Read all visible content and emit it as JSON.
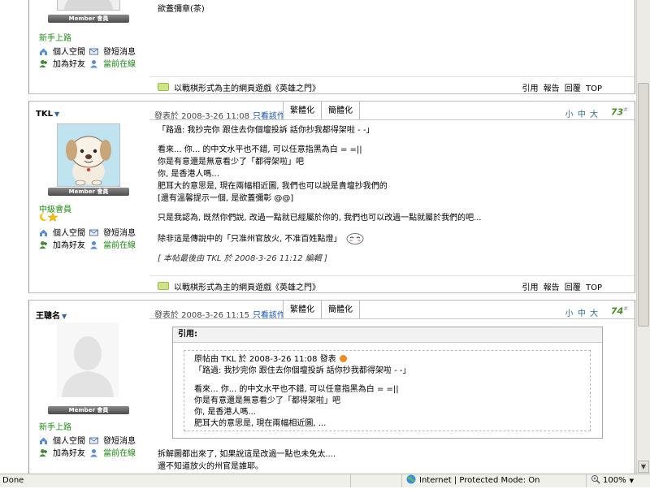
{
  "post_top": {
    "badge": "Member 會員",
    "rank": "新手上路",
    "links": {
      "space": "個人空間",
      "message": "發短消息",
      "add_friend": "加為好友",
      "online": "當前在線"
    },
    "content_tail": "欲蓋彌章(茶)",
    "footer_ad": "以戰棋形式為主的網頁遊戲《英雄之門》",
    "actions": "引用 報告 回覆 TOP"
  },
  "post_tkl": {
    "author": "TKL",
    "date": "發表於 2008-3-26 11:08",
    "only_author": "只看該作者",
    "tab_trad": "繁體化",
    "tab_simp": "簡體化",
    "fontsize": "小 中 大",
    "floor": "73",
    "badge": "Member 會員",
    "rank": "中級會員",
    "links": {
      "space": "個人空間",
      "message": "發短消息",
      "add_friend": "加為好友",
      "online": "當前在線"
    },
    "content": [
      "「路過: 我抄完你 跟住去你個壇投訴 話你抄我都得架啦 - -」",
      "看來... 你... 的中文水平也不錯, 可以任意指黑為白 = =||",
      "你是有意還是無意看少了「都得架啦」吧",
      "你, 是香港人嗎...",
      "肥耳大的意思是, 現在兩幅相近圖, 我們也可以說是貴壇抄我們的",
      "[還有溫馨提示一個, 是欲蓋彌彰 @@]",
      "只是我認為, 既然你們說, 改過一點就已經屬於你的, 我們也可以改過一點就屬於我們的吧...",
      "除非這是傳說中的「只准州官放火, 不准百姓點燈」",
      "[ 本帖最後由 TKL 於 2008-3-26 11:12 編輯 ]"
    ],
    "footer_ad": "以戰棋形式為主的網頁遊戲《英雄之門》",
    "actions": "引用 報告 回覆 TOP"
  },
  "post_wang": {
    "author": "王聰名",
    "date": "發表於 2008-3-26 11:15",
    "only_author": "只看該作者",
    "tab_trad": "繁體化",
    "tab_simp": "簡體化",
    "fontsize": "小 中 大",
    "floor": "74",
    "badge": "Member 會員",
    "rank": "新手上路",
    "links": {
      "space": "個人空間",
      "message": "發短消息",
      "add_friend": "加為好友",
      "online": "當前在線"
    },
    "quote_title": "引用:",
    "quote_source": "原帖由 TKL 於 2008-3-26 11:08 發表",
    "quote_lines": [
      "「路過: 我抄完你 跟住去你個壇投訴 話你抄我都得架啦 - -」",
      "看來... 你... 的中文水平也不錯, 可以任意指黑為白 = =||",
      "你是有意還是無意看少了「都得架啦」吧",
      "你, 是香港人嗎...",
      "肥耳大的意思是, 現在兩幅相近圖, ..."
    ],
    "content": [
      "拆解圖都出來了, 如果說這是改過一點也未免太....",
      "還不知道放火的州官是誰耶。"
    ]
  },
  "statusbar": {
    "left": "Done",
    "zone": "Internet | Protected Mode: On",
    "zoom": "100%"
  },
  "colors": {
    "online_green": "#1e8a14",
    "link_blue": "#1a56a8",
    "floor_green": "#4a8b2a"
  }
}
